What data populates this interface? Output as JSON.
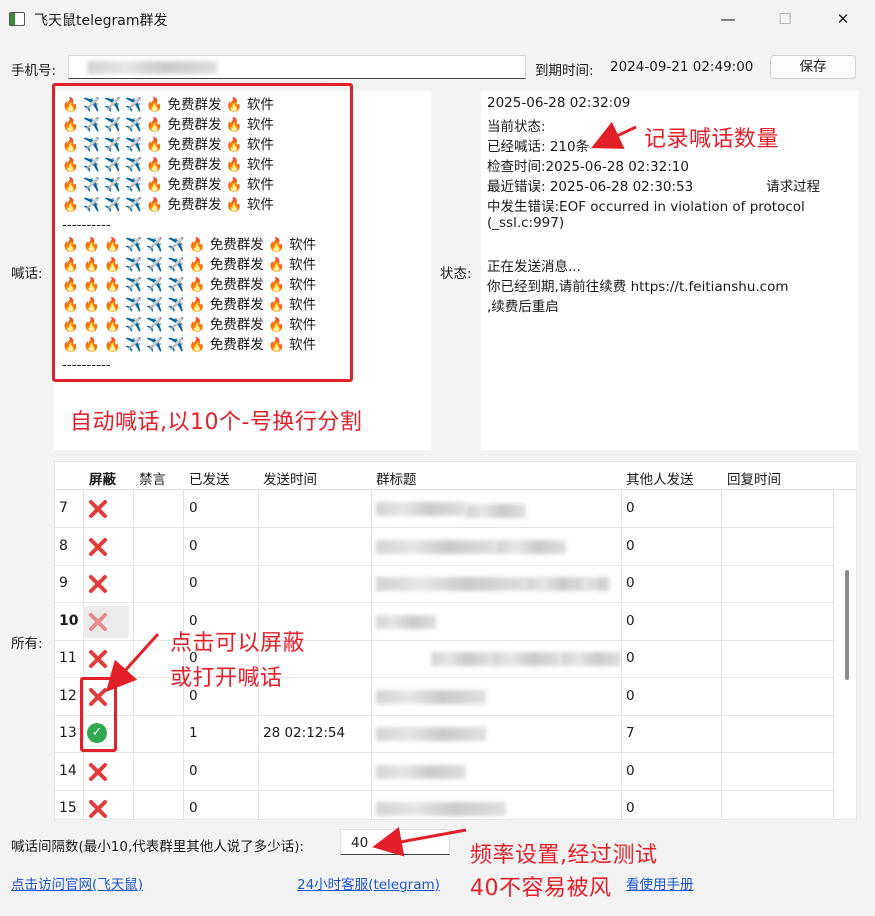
{
  "window": {
    "title": "飞天鼠telegram群发",
    "minimize_glyph": "—",
    "maximize_glyph": "☐",
    "close_glyph": "✕"
  },
  "top": {
    "phone_label": "手机号:",
    "expire_label": "到期时间:",
    "expire_value": "2024-09-21 02:49:00",
    "save_label": "保存"
  },
  "shout": {
    "label": "喊话:",
    "lines": [
      "🔥 ✈️ ✈️ ✈️ 🔥 免费群发 🔥 软件",
      "🔥 ✈️ ✈️ ✈️ 🔥 免费群发 🔥 软件",
      "🔥 ✈️ ✈️ ✈️ 🔥 免费群发 🔥 软件",
      "🔥 ✈️ ✈️ ✈️ 🔥 免费群发 🔥 软件",
      "🔥 ✈️ ✈️ ✈️ 🔥 免费群发 🔥 软件",
      "🔥 ✈️ ✈️ ✈️ 🔥 免费群发 🔥 软件",
      "----------",
      "🔥 🔥 🔥 ✈️ ✈️ ✈️ 🔥 免费群发 🔥 软件",
      "🔥 🔥 🔥 ✈️ ✈️ ✈️ 🔥 免费群发 🔥 软件",
      "🔥 🔥 🔥 ✈️ ✈️ ✈️ 🔥 免费群发 🔥 软件",
      "🔥 🔥 🔥 ✈️ ✈️ ✈️ 🔥 免费群发 🔥 软件",
      "🔥 🔥 🔥 ✈️ ✈️ ✈️ 🔥 免费群发 🔥 软件",
      "🔥 🔥 🔥 ✈️ ✈️ ✈️ 🔥 免费群发 🔥 软件",
      "----------"
    ]
  },
  "status": {
    "label": "状态:",
    "lines": [
      "2025-06-28 02:32:09",
      "当前状态:",
      "已经喊话: 210条",
      "检查时间:2025-06-28 02:32:10",
      "最近错误: 2025-06-28 02:30:53                 请求过程",
      "中发生错误:EOF occurred in violation of protocol",
      "(_ssl.c:997)",
      "",
      "正在发送消息...",
      "你已经到期,请前往续费 https://t.feitianshu.com",
      ",续费后重启"
    ]
  },
  "table": {
    "label": "所有:",
    "headers": [
      "屏蔽",
      "禁言",
      "已发送",
      "发送时间",
      "群标题",
      "其他人发送",
      "回复时间"
    ],
    "rows": [
      {
        "num": "7",
        "blocked": true,
        "sent": "0",
        "time": "",
        "others": "0"
      },
      {
        "num": "8",
        "blocked": true,
        "sent": "0",
        "time": "",
        "others": "0"
      },
      {
        "num": "9",
        "blocked": true,
        "sent": "0",
        "time": "",
        "others": "0"
      },
      {
        "num": "10",
        "blocked": true,
        "sent": "0",
        "time": "",
        "others": "0",
        "selected": true
      },
      {
        "num": "11",
        "blocked": true,
        "sent": "0",
        "time": "",
        "others": "0"
      },
      {
        "num": "12",
        "blocked": true,
        "sent": "0",
        "time": "",
        "others": "0"
      },
      {
        "num": "13",
        "blocked": false,
        "sent": "1",
        "time": "28 02:12:54",
        "others": "7"
      },
      {
        "num": "14",
        "blocked": true,
        "sent": "0",
        "time": "",
        "others": "0"
      },
      {
        "num": "15",
        "blocked": true,
        "sent": "0",
        "time": "",
        "others": "0"
      }
    ]
  },
  "bottom": {
    "interval_label": "喊话间隔数(最小10,代表群里其他人说了多少话):",
    "interval_value": "40",
    "link_site": "点击访问官网(飞天鼠)",
    "link_support": "24小时客服(telegram)",
    "link_manual": "看使用手册"
  },
  "annotations": {
    "count": "记录喊话数量",
    "auto": "自动喊话,以10个-号换行分割",
    "toggle_1": "点击可以屏蔽",
    "toggle_2": "或打开喊话",
    "freq_1": "频率设置,经过测试",
    "freq_2": "40不容易被风"
  },
  "colors": {
    "annotation_red": "#e3202a",
    "link_blue": "#1a56c9",
    "check_green": "#2fa84f",
    "x_red": "#e23b3b"
  },
  "icons": {
    "blocked": "red-x-icon",
    "enabled": "green-check-icon"
  }
}
